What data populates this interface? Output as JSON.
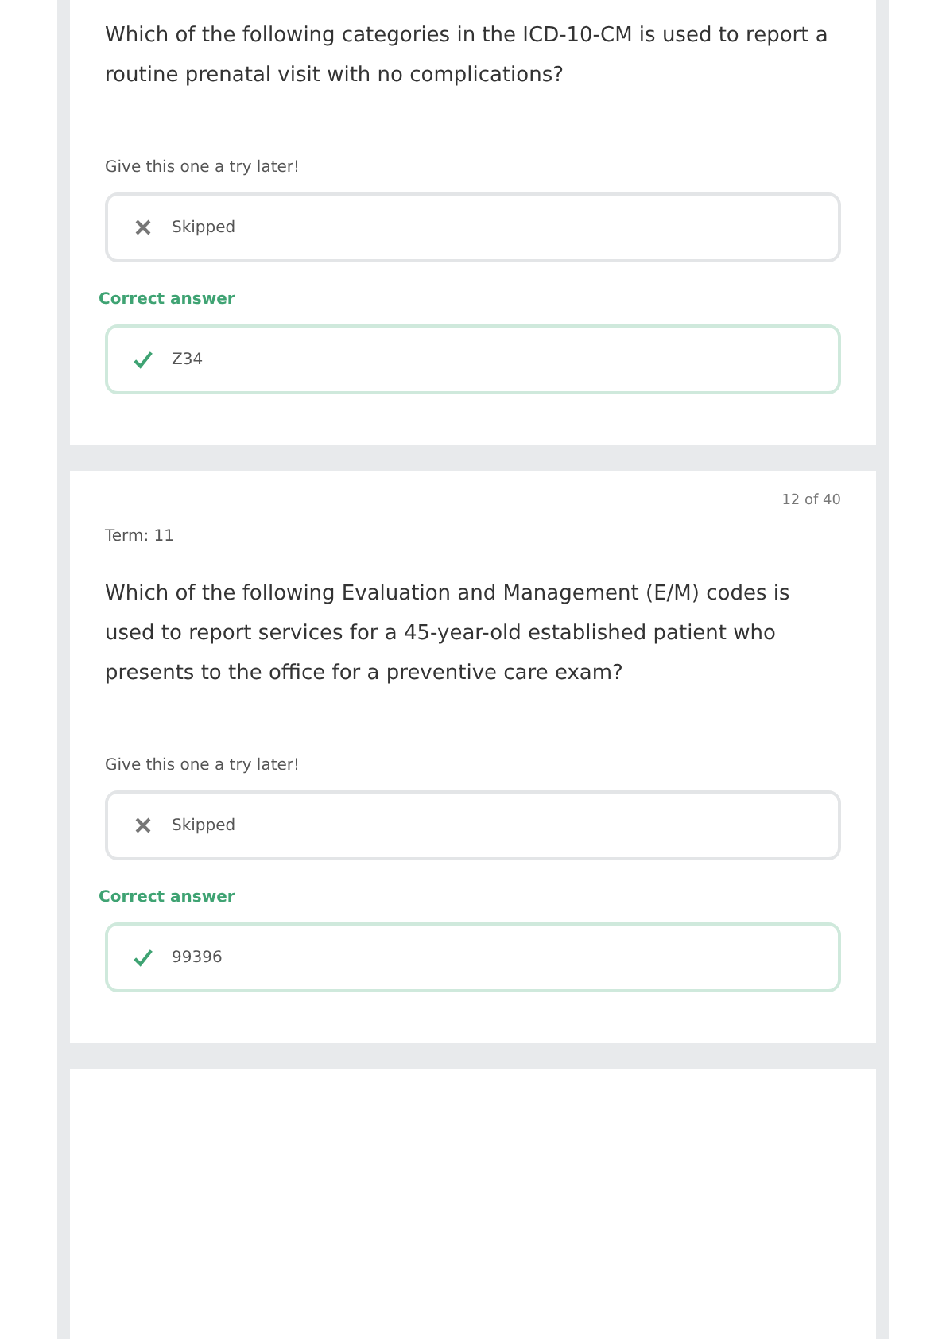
{
  "cards": [
    {
      "question": "Which of the following categories in the ICD-10-CM is used to report a routine prenatal visit with no complications?",
      "prompt": "Give this one a try later!",
      "your_answer": "Skipped",
      "correct_label": "Correct answer",
      "correct_answer": "Z34"
    },
    {
      "counter": "12 of 40",
      "term": "Term: 11",
      "question": "Which of the following Evaluation and Management (E/M) codes is used to report services for a 45-year-old established patient who presents to the office for a preventive care exam?",
      "prompt": "Give this one a try later!",
      "your_answer": "Skipped",
      "correct_label": "Correct answer",
      "correct_answer": "99396"
    }
  ]
}
